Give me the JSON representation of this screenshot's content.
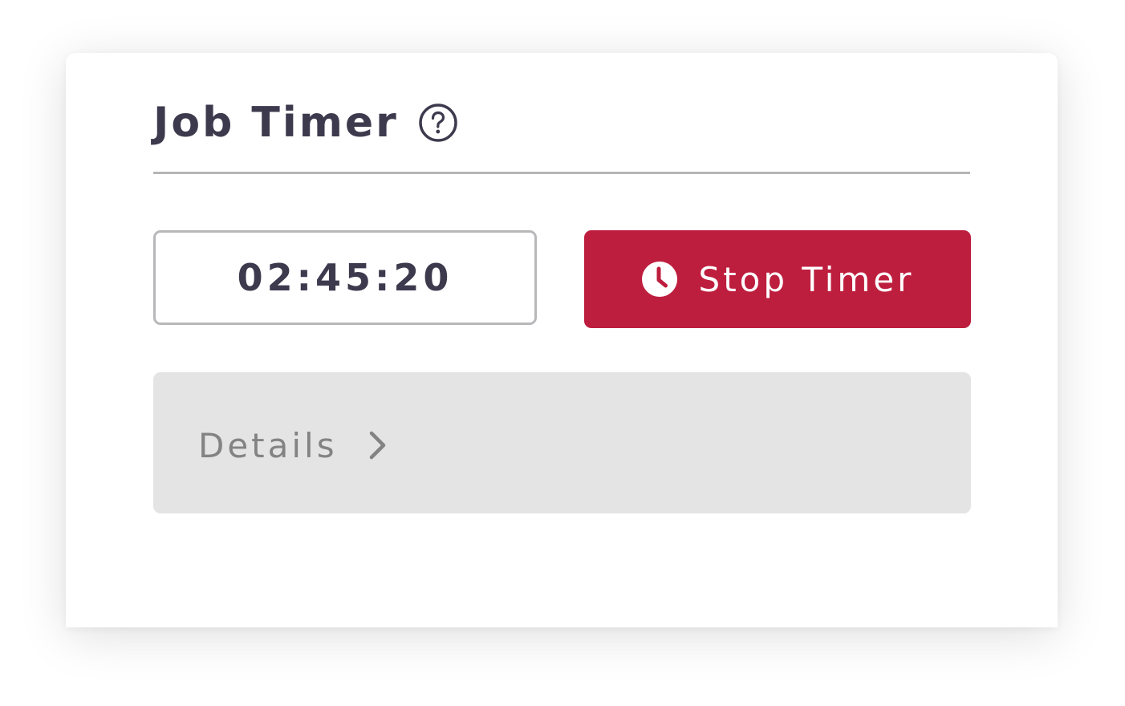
{
  "widget": {
    "title": "Job Timer",
    "help_icon": "question-circle-icon"
  },
  "timer": {
    "value": "02:45:20"
  },
  "stop_button": {
    "label": "Stop Timer",
    "icon": "clock-icon",
    "color": "#be1e3e"
  },
  "details": {
    "label": "Details",
    "icon": "chevron-right-icon"
  },
  "colors": {
    "text_dark": "#3d3a4e",
    "panel_gray": "#e4e4e4",
    "muted_text": "#838383"
  }
}
